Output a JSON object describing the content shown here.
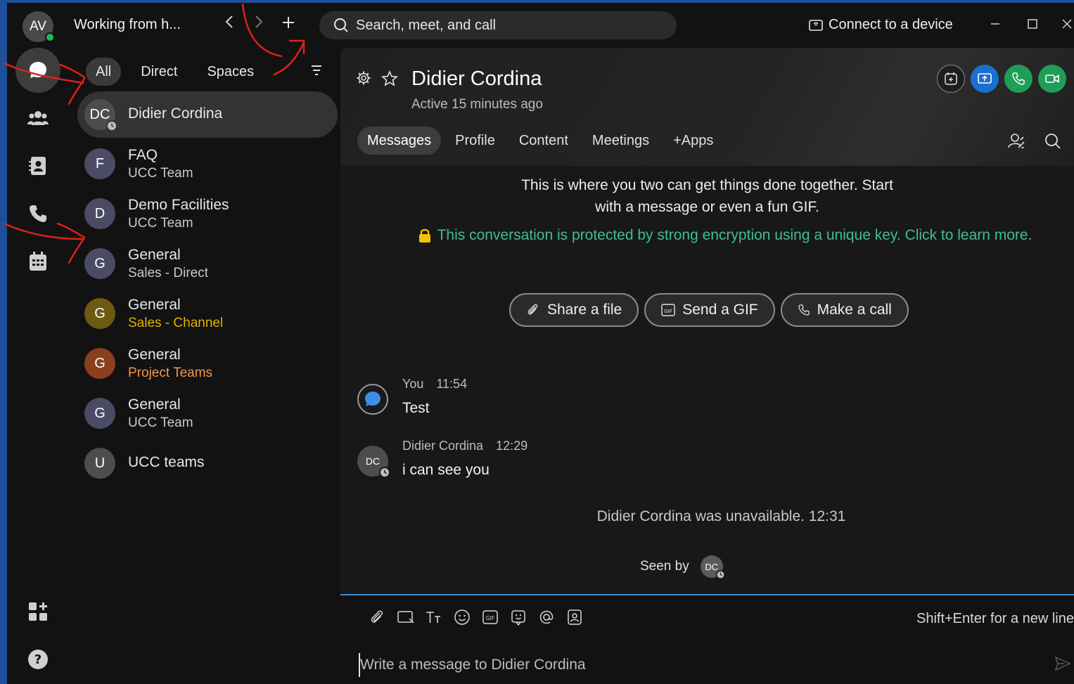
{
  "topbar": {
    "avatar_initials": "AV",
    "status_text": "Working from h...",
    "search_placeholder": "Search, meet, and call",
    "connect_label": "Connect to a device"
  },
  "filters": [
    "All",
    "Direct",
    "Spaces"
  ],
  "conversations": [
    {
      "initials": "DC",
      "title": "Didier Cordina",
      "subtitle": "",
      "avatar_color": "#4d4d4d",
      "sub_color": ""
    },
    {
      "initials": "F",
      "title": "FAQ",
      "subtitle": "UCC Team",
      "avatar_color": "#4b4b66",
      "sub_color": "#c9c9c9"
    },
    {
      "initials": "D",
      "title": "Demo Facilities",
      "subtitle": "UCC Team",
      "avatar_color": "#4b4b66",
      "sub_color": "#c9c9c9"
    },
    {
      "initials": "G",
      "title": "General",
      "subtitle": "Sales - Direct",
      "avatar_color": "#4b4b66",
      "sub_color": "#c9c9c9"
    },
    {
      "initials": "G",
      "title": "General",
      "subtitle": "Sales - Channel",
      "avatar_color": "#6e5a12",
      "sub_color": "#e0b400"
    },
    {
      "initials": "G",
      "title": "General",
      "subtitle": "Project Teams",
      "avatar_color": "#8a3f1e",
      "sub_color": "#f0964d"
    },
    {
      "initials": "G",
      "title": "General",
      "subtitle": "UCC Team",
      "avatar_color": "#4b4b66",
      "sub_color": "#c9c9c9"
    },
    {
      "initials": "U",
      "title": "UCC teams",
      "subtitle": "",
      "avatar_color": "#4d4d4d",
      "sub_color": ""
    }
  ],
  "chat": {
    "title": "Didier Cordina",
    "status": "Active 15 minutes ago",
    "tabs": [
      "Messages",
      "Profile",
      "Content",
      "Meetings",
      "+Apps"
    ],
    "intro_line1": "This is where you two can get things done together. Start",
    "intro_line2": "with a message or even a fun GIF.",
    "encryption_text": "This conversation is protected by strong encryption using a unique key. Click to learn more.",
    "quick_actions": [
      "Share a file",
      "Send a GIF",
      "Make a call"
    ],
    "messages": [
      {
        "sender": "You",
        "time": "11:54",
        "text": "Test",
        "avatar": ""
      },
      {
        "sender": "Didier Cordina",
        "time": "12:29",
        "text": "i can see you",
        "avatar": "DC"
      }
    ],
    "system_message": "Didier Cordina was unavailable. 12:31",
    "seen_by_label": "Seen by",
    "seen_by_initials": "DC"
  },
  "composer": {
    "hint": "Shift+Enter for a new line",
    "placeholder": "Write a message to Didier Cordina"
  },
  "colors": {
    "accent_blue": "#1c6fd1",
    "call_green": "#1e9e57",
    "encryption_green": "#3fbf8a",
    "annotation_red": "#e0201b"
  }
}
